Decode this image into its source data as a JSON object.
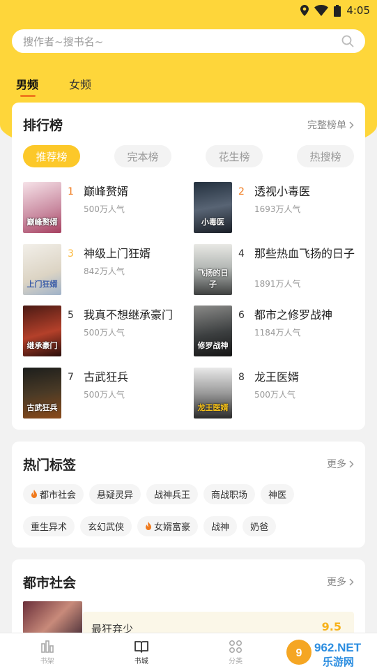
{
  "status": {
    "time": "4:05"
  },
  "search": {
    "placeholder": "搜作者~搜书名~"
  },
  "tabs": [
    {
      "label": "男频",
      "active": true
    },
    {
      "label": "女频",
      "active": false
    }
  ],
  "ranking": {
    "title": "排行榜",
    "more": "完整榜单",
    "pills": [
      {
        "label": "推荐榜",
        "active": true
      },
      {
        "label": "完本榜",
        "active": false
      },
      {
        "label": "花生榜",
        "active": false
      },
      {
        "label": "热搜榜",
        "active": false
      }
    ],
    "books": [
      {
        "rank": "1",
        "title": "巅峰赘婿",
        "popularity": "500万人气",
        "cover_text": "巅峰赘婿"
      },
      {
        "rank": "2",
        "title": "透视小毒医",
        "popularity": "1693万人气",
        "cover_text": "小毒医"
      },
      {
        "rank": "3",
        "title": "神级上门狂婿",
        "popularity": "842万人气",
        "cover_text": "上门狂婿"
      },
      {
        "rank": "4",
        "title": "那些热血飞扬的日子",
        "popularity": "1891万人气",
        "cover_text": "飞扬的日子"
      },
      {
        "rank": "5",
        "title": "我真不想继承豪门",
        "popularity": "500万人气",
        "cover_text": "继承豪门"
      },
      {
        "rank": "6",
        "title": "都市之修罗战神",
        "popularity": "1184万人气",
        "cover_text": "修罗战神"
      },
      {
        "rank": "7",
        "title": "古武狂兵",
        "popularity": "500万人气",
        "cover_text": "古武狂兵"
      },
      {
        "rank": "8",
        "title": "龙王医婿",
        "popularity": "500万人气",
        "cover_text": "龙王医婿"
      }
    ]
  },
  "hot_tags": {
    "title": "热门标签",
    "more": "更多",
    "row1": [
      {
        "label": "都市社会",
        "hot": true
      },
      {
        "label": "悬疑灵异",
        "hot": false
      },
      {
        "label": "战神兵王",
        "hot": false
      },
      {
        "label": "商战职场",
        "hot": false
      },
      {
        "label": "神医",
        "hot": false
      }
    ],
    "row2": [
      {
        "label": "重生异术",
        "hot": false
      },
      {
        "label": "玄幻武侠",
        "hot": false
      },
      {
        "label": "女婿富豪",
        "hot": true
      },
      {
        "label": "战神",
        "hot": false
      },
      {
        "label": "奶爸",
        "hot": false
      }
    ]
  },
  "section": {
    "title": "都市社会",
    "more": "更多",
    "featured_title": "最狂弃少",
    "featured_score": "9.5"
  },
  "bottom_nav": [
    {
      "label": "书架",
      "icon": "bookshelf-icon",
      "active": false
    },
    {
      "label": "书城",
      "icon": "book-open-icon",
      "active": true
    },
    {
      "label": "分类",
      "icon": "category-icon",
      "active": false
    },
    {
      "label": "",
      "icon": "",
      "active": false
    }
  ],
  "watermark": {
    "top": "962.NET",
    "bottom": "乐游网"
  },
  "colors": {
    "accent_yellow": "#fed63a",
    "pill_active": "#fcc829",
    "rank_orange": "#f07a1d",
    "score_yellow": "#f7b21a"
  }
}
